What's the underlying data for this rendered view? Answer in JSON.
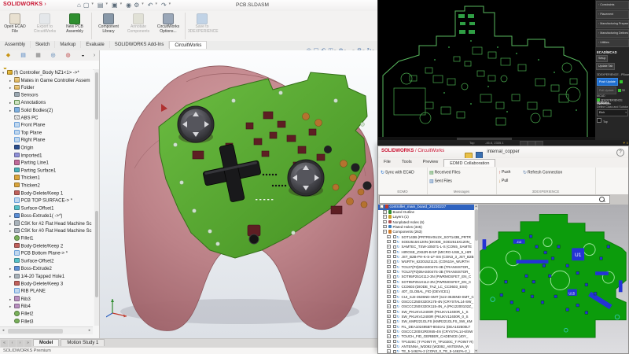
{
  "main_window": {
    "logo_text": "SOLIDWORKS",
    "title": "PCB.SLDASM",
    "quick_icons": [
      "home-icon",
      "new-document-icon",
      "open-icon",
      "save-icon",
      "rebuild-icon",
      "options-icon",
      "undo-icon",
      "redo-icon"
    ],
    "ribbon_buttons": [
      {
        "label": "Open ECAD File",
        "enabled": true,
        "icon": "open-ecad-icon"
      },
      {
        "label": "Export to CircuitWorks",
        "enabled": false,
        "icon": "export-circuitworks-icon"
      },
      {
        "label": "New PCB Assembly",
        "enabled": true,
        "icon": "new-pcb-icon"
      },
      {
        "label": "Component Library",
        "enabled": true,
        "icon": "component-library-icon"
      },
      {
        "label": "Annotate Components",
        "enabled": false,
        "icon": "annotate-components-icon"
      },
      {
        "label": "CircuitWorks Options...",
        "enabled": true,
        "icon": "circuitworks-options-icon"
      },
      {
        "label": "Save to 3DEXPERIENCE",
        "enabled": false,
        "icon": "save-3dexperience-icon"
      }
    ],
    "command_tabs": [
      "Assembly",
      "Sketch",
      "Markup",
      "Evaluate",
      "SOLIDWORKS Add-Ins",
      "CircuitWorks"
    ],
    "active_command_tab": "CircuitWorks",
    "viewport_icons": [
      "zoom-fit-icon",
      "zoom-area-icon",
      "previous-view-icon",
      "section-view-icon",
      "display-style-icon",
      "hide-show-items-icon",
      "view-settings-icon",
      "rotate-view-icon"
    ],
    "feature_tree": [
      {
        "label": "(f) Controller_Body NZ1<1> ->*",
        "icon": "part",
        "arrow": "expanded",
        "level": 0
      },
      {
        "label": "Mates in Game Controller Assem",
        "icon": "mates-folder",
        "arrow": "collapsed",
        "level": 1
      },
      {
        "label": "Folder",
        "icon": "folder",
        "arrow": "collapsed",
        "level": 1
      },
      {
        "label": "Sensors",
        "icon": "sensors",
        "level": 1
      },
      {
        "label": "Annotations",
        "icon": "annotations",
        "arrow": "collapsed",
        "level": 1
      },
      {
        "label": "Solid Bodies(2)",
        "icon": "solid-bodies",
        "arrow": "collapsed",
        "level": 1
      },
      {
        "label": "ABS PC",
        "icon": "material",
        "level": 1
      },
      {
        "label": "Front Plane",
        "icon": "plane",
        "level": 1
      },
      {
        "label": "Top Plane",
        "icon": "plane",
        "level": 1
      },
      {
        "label": "Right Plane",
        "icon": "plane",
        "level": 1
      },
      {
        "label": "Origin",
        "icon": "origin",
        "level": 1
      },
      {
        "label": "Imported1",
        "icon": "imported",
        "level": 1
      },
      {
        "label": "Parting Line1",
        "icon": "parting-line",
        "level": 1
      },
      {
        "label": "Parting Surface1",
        "icon": "parting-surface",
        "level": 1
      },
      {
        "label": "Thicken1",
        "icon": "thicken",
        "level": 1
      },
      {
        "label": "Thicken2",
        "icon": "thicken",
        "level": 1
      },
      {
        "label": "Body-Delete/Keep 1",
        "icon": "body-delete",
        "level": 1
      },
      {
        "label": "PCB TOP SURFACE-> *",
        "icon": "plane",
        "level": 1
      },
      {
        "label": "Surface-Offset1",
        "icon": "surface-offset",
        "level": 1
      },
      {
        "label": "Boss-Extrude1( ->*)",
        "icon": "boss-extrude",
        "arrow": "collapsed",
        "level": 1
      },
      {
        "label": "CSK for #2 Flat Head Machine Sc",
        "icon": "hole-wizard",
        "arrow": "collapsed",
        "level": 1
      },
      {
        "label": "CSK for #0 Flat Head Machine Sc",
        "icon": "hole-wizard",
        "arrow": "collapsed",
        "level": 1
      },
      {
        "label": "Fillet1",
        "icon": "fillet",
        "level": 1
      },
      {
        "label": "Body-Delete/Keep 2",
        "icon": "body-delete",
        "level": 1
      },
      {
        "label": "PCB Bottom Plane-> *",
        "icon": "plane",
        "level": 1
      },
      {
        "label": "Surface-Offset2",
        "icon": "surface-offset",
        "level": 1
      },
      {
        "label": "Boss-Extrude2",
        "icon": "boss-extrude",
        "arrow": "collapsed",
        "level": 1
      },
      {
        "label": "1/4-20 Tapped Hole1",
        "icon": "hole-wizard",
        "arrow": "collapsed",
        "level": 1
      },
      {
        "label": "Body-Delete/Keep 3",
        "icon": "body-delete",
        "level": 1
      },
      {
        "label": "RIB PLANE",
        "icon": "plane",
        "level": 1
      },
      {
        "label": "Rib3",
        "icon": "rib",
        "arrow": "collapsed",
        "level": 1
      },
      {
        "label": "Rib4",
        "icon": "rib",
        "arrow": "collapsed",
        "level": 1
      },
      {
        "label": "Fillet2",
        "icon": "fillet",
        "level": 1
      },
      {
        "label": "Fillet3",
        "icon": "fillet",
        "level": 1
      }
    ],
    "bottom_tabs": [
      "Model",
      "Motion Study 1"
    ],
    "active_bottom_tab": "Model",
    "status_text": "SOLIDWORKS Premium"
  },
  "ecad_editor": {
    "panel_sections": [
      "Constraints",
      "Placement",
      "Manufacturing Preparation",
      "Manufacturing Deliverables",
      "Utilities"
    ],
    "ecad_mcad_header": "ECAD/MCAD",
    "setup_button": "Setup",
    "update_tab_button": "Update Tab",
    "connection_label": "3DEXPERIENCE - PBoard_gen...",
    "push_button": "Push Update",
    "pull_button": "Pull Update",
    "mcad_label": "3D MCAD",
    "connection_status": "3DEXPERIENCE Connection",
    "options": {
      "header": "Options",
      "subtitle": "Define Class and Subclass",
      "dropdown_value": "Etch",
      "checkbox_label": "Top"
    },
    "statusbar": {
      "view_label": "Top",
      "coords": "-46.6, 2335.1",
      "right_count": "0"
    }
  },
  "circuitworks_window": {
    "logo_text": "SOLIDWORKS",
    "logo_suffix": " / CircuitWorks",
    "title": "internal_copper",
    "help_label": "?",
    "menu_tabs": [
      "File",
      "Tools",
      "Preview",
      "EDMD Collaboration"
    ],
    "active_menu_tab": "EDMD Collaboration",
    "ribbon_groups": [
      {
        "label": "EDMD",
        "buttons": [
          {
            "label": "Sync with ECAD",
            "icon": "sync-icon"
          }
        ]
      },
      {
        "label": "Messages",
        "buttons": [
          {
            "label": "Received Files",
            "icon": "received-files-icon"
          },
          {
            "label": "Sent Files",
            "icon": "sent-files-icon"
          }
        ]
      },
      {
        "label": "3DEXPERIENCE",
        "buttons": [
          {
            "label": "Push",
            "icon": "push-icon"
          },
          {
            "label": "Pull",
            "icon": "pull-icon"
          },
          {
            "label": "Refresh Connection",
            "icon": "refresh-connection-icon"
          }
        ]
      }
    ],
    "search_value": "",
    "tree": {
      "root": "controller_main_board_20230237",
      "groups": [
        {
          "label": "Board Outline",
          "icon": "board-outline"
        },
        {
          "label": "Layers (1)",
          "icon": "layers"
        },
        {
          "label": "Nonplated Holes (6)",
          "icon": "nonplated-holes"
        },
        {
          "label": "Plated Holes (345)",
          "icon": "plated-holes"
        },
        {
          "label": "Components (263)",
          "icon": "components"
        }
      ],
      "components": [
        "SOT143B (PRTR5V0U2X_SOT143B_PRTR",
        "SOD2515X120N (DIODE_SOD2515X120N_",
        "SAMTEC_TSW-105071-L-S (CON5_SAMTE",
        "HIROSE_ZX62R-B-5P (MICRO-USB_5_HIR",
        "JST_B2B-PH-K-S-LF-SN (CON3_3_JST_B2B",
        "WURTH_62201521121 (CON10A_WURTH",
        "TO127(P3)06AS0047S-3B (TRANSISTOR_",
        "TO127(P3)06AS0047S-3B (TRANSISTOR_",
        "SOT95P251X112-3N (PWRMOSFET_EN_C",
        "SOT95P251X112-3N (PWRMOSFET_EN_C",
        "CC0603 (DIODE_TAZ_LC_CC0603_ES0)",
        "40T_GLOBAL_FID (DEVICE1)",
        "CUI_SJ2-3535ND-SMT (SJ2-3535ND-SMT_C",
        "OSCCC250X320X175-4N (CRYSTAL14-SW_",
        "OSCCC250X320X115-4N_A (PK12200102Z_",
        "SW_PKUKV12400R (PKUKV12400R_1_S",
        "SW_PKUKV12400R (PKUKV12400R_0_S",
        "SW_KMR221GLFS (KMR221GLFS_SW_KM",
        "FIL_DEA102495BT-8044A1 (DEA102500LT",
        "OSCCC200X2R0X65-4N (CRYSTAL14-6/SW",
        "TOUCH_FID_GERBER_CADENCE (40Y_",
        "TP1020C (T POINT R_TP1020C_T POINT R)",
        "ANTENNA_W3092 (W3092_ANTENNA_W",
        "TE_5-1462%-2 (CON3_0_TE_5-1462%-2_)"
      ]
    },
    "pcb_labels": {
      "u1": "U1",
      "u15": "U15",
      "j13": "J13"
    }
  },
  "colors": {
    "sw_red": "#c8102e",
    "selection_blue": "#2f63c0",
    "push_button_blue": "#1f6fd0",
    "pcb_green": "#0c9c0c",
    "led_green": "#35c42f"
  }
}
